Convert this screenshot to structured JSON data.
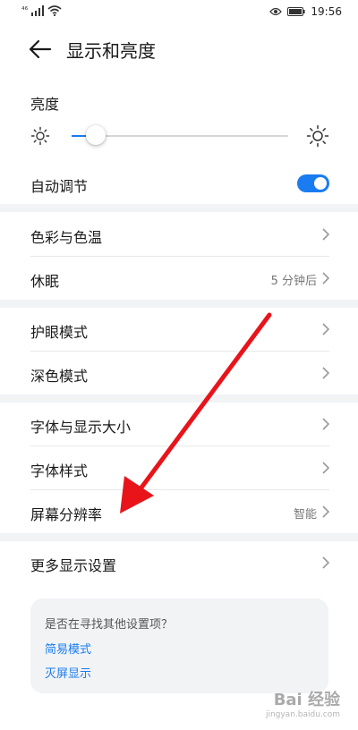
{
  "status_bar": {
    "signal": "⁴⁶",
    "time": "19:56"
  },
  "header": {
    "title": "显示和亮度"
  },
  "brightness": {
    "label": "亮度",
    "level_percent": 11
  },
  "auto_adjust": {
    "label": "自动调节",
    "enabled": true
  },
  "groups": [
    [
      {
        "label": "色彩与色温",
        "value": ""
      },
      {
        "label": "休眠",
        "value": "5 分钟后"
      }
    ],
    [
      {
        "label": "护眼模式",
        "value": ""
      },
      {
        "label": "深色模式",
        "value": ""
      }
    ],
    [
      {
        "label": "字体与显示大小",
        "value": ""
      },
      {
        "label": "字体样式",
        "value": ""
      },
      {
        "label": "屏幕分辨率",
        "value": "智能"
      }
    ],
    [
      {
        "label": "更多显示设置",
        "value": ""
      }
    ]
  ],
  "suggestions": {
    "question": "是否在寻找其他设置项？",
    "links": [
      "简易模式",
      "灭屏显示"
    ]
  },
  "watermark": {
    "line1": "Bai 经验",
    "line2": "jingyan.baidu.com"
  },
  "colors": {
    "accent": "#1a7cf0",
    "annotation_arrow": "#e8141a"
  }
}
